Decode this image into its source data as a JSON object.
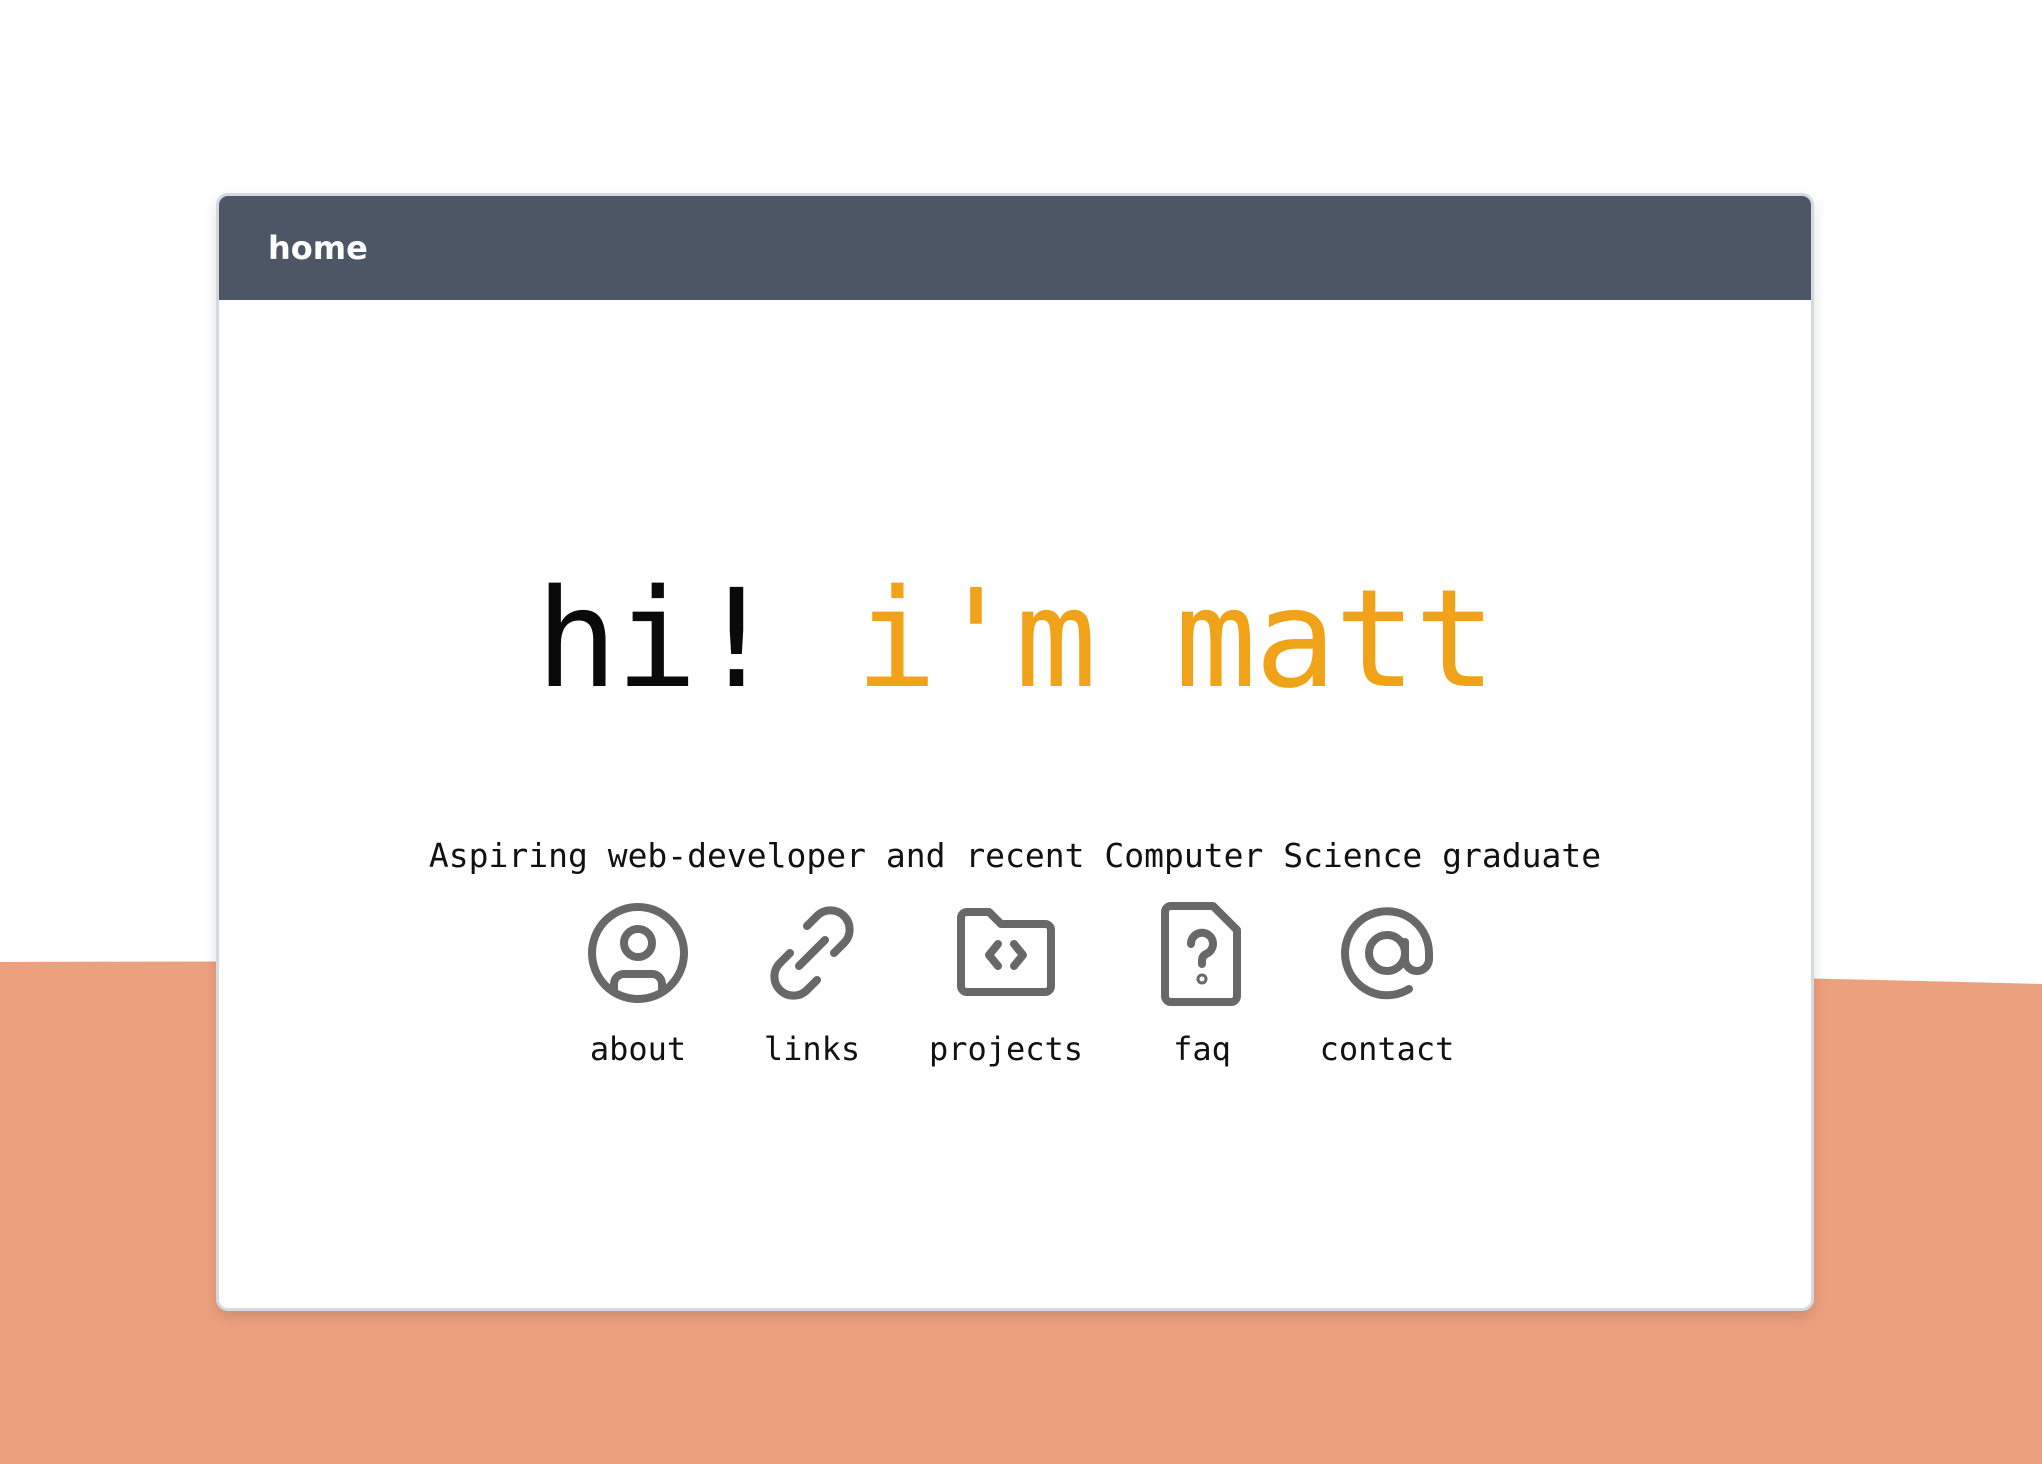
{
  "colors": {
    "background": "#ffffff",
    "wave": "#eca17e",
    "titlebar": "#4d5665",
    "accent": "#f0a318",
    "icon": "#686868"
  },
  "window": {
    "title": "home"
  },
  "hero": {
    "greeting": "hi! ",
    "name": "i'm matt",
    "tagline": "Aspiring web-developer and recent Computer Science graduate"
  },
  "nav": {
    "items": [
      {
        "label": "about",
        "icon": "user-circle-icon"
      },
      {
        "label": "links",
        "icon": "link-icon"
      },
      {
        "label": "projects",
        "icon": "code-folder-icon"
      },
      {
        "label": "faq",
        "icon": "question-file-icon"
      },
      {
        "label": "contact",
        "icon": "at-sign-icon"
      }
    ]
  }
}
